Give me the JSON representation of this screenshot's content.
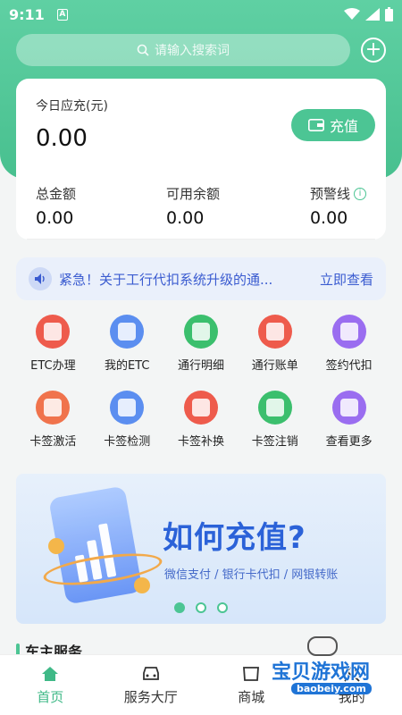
{
  "status": {
    "time": "9:11",
    "notif": "A"
  },
  "search": {
    "placeholder": "请输入搜索词"
  },
  "card": {
    "today_label": "今日应充(元)",
    "today_value": "0.00",
    "recharge_label": "充值",
    "stats": [
      {
        "label": "总金额",
        "value": "0.00"
      },
      {
        "label": "可用余额",
        "value": "0.00"
      },
      {
        "label": "预警线",
        "value": "0.00"
      }
    ]
  },
  "notice": {
    "text": "紧急！关于工行代扣系统升级的通...",
    "link": "立即查看"
  },
  "services": [
    {
      "label": "ETC办理",
      "icon": "etc-apply-icon",
      "color": "#ee5b4c"
    },
    {
      "label": "我的ETC",
      "icon": "my-etc-card-icon",
      "color": "#5b8ef0"
    },
    {
      "label": "通行明细",
      "icon": "pass-detail-icon",
      "color": "#3bbf6d"
    },
    {
      "label": "通行账单",
      "icon": "pass-bill-icon",
      "color": "#ee5b4c"
    },
    {
      "label": "签约代扣",
      "icon": "sign-withhold-icon",
      "color": "#9a6df0"
    },
    {
      "label": "卡签激活",
      "icon": "tag-activate-icon",
      "color": "#f0734c"
    },
    {
      "label": "卡签检测",
      "icon": "tag-detect-icon",
      "color": "#5b8ef0"
    },
    {
      "label": "卡签补换",
      "icon": "tag-replace-icon",
      "color": "#ee5b4c"
    },
    {
      "label": "卡签注销",
      "icon": "tag-cancel-icon",
      "color": "#3bbf6d"
    },
    {
      "label": "查看更多",
      "icon": "more-icon",
      "color": "#9a6df0"
    }
  ],
  "banner": {
    "title": "如何充值?",
    "subtitle": "微信支付 / 银行卡代扣 / 网银转账",
    "active_dot": 0,
    "dot_count": 3
  },
  "section": {
    "title": "车主服务"
  },
  "tabs": [
    {
      "label": "首页",
      "icon": "home-icon",
      "active": true
    },
    {
      "label": "服务大厅",
      "icon": "car-icon",
      "active": false
    },
    {
      "label": "商城",
      "icon": "shop-icon",
      "active": false
    },
    {
      "label": "我的",
      "icon": "profile-icon",
      "active": false
    }
  ],
  "watermark": {
    "text": "宝贝游戏网",
    "url": "baobeiy.com"
  },
  "colors": {
    "brand": "#4cc594",
    "notice": "#3a5bd0",
    "banner_title": "#2b62d8"
  }
}
